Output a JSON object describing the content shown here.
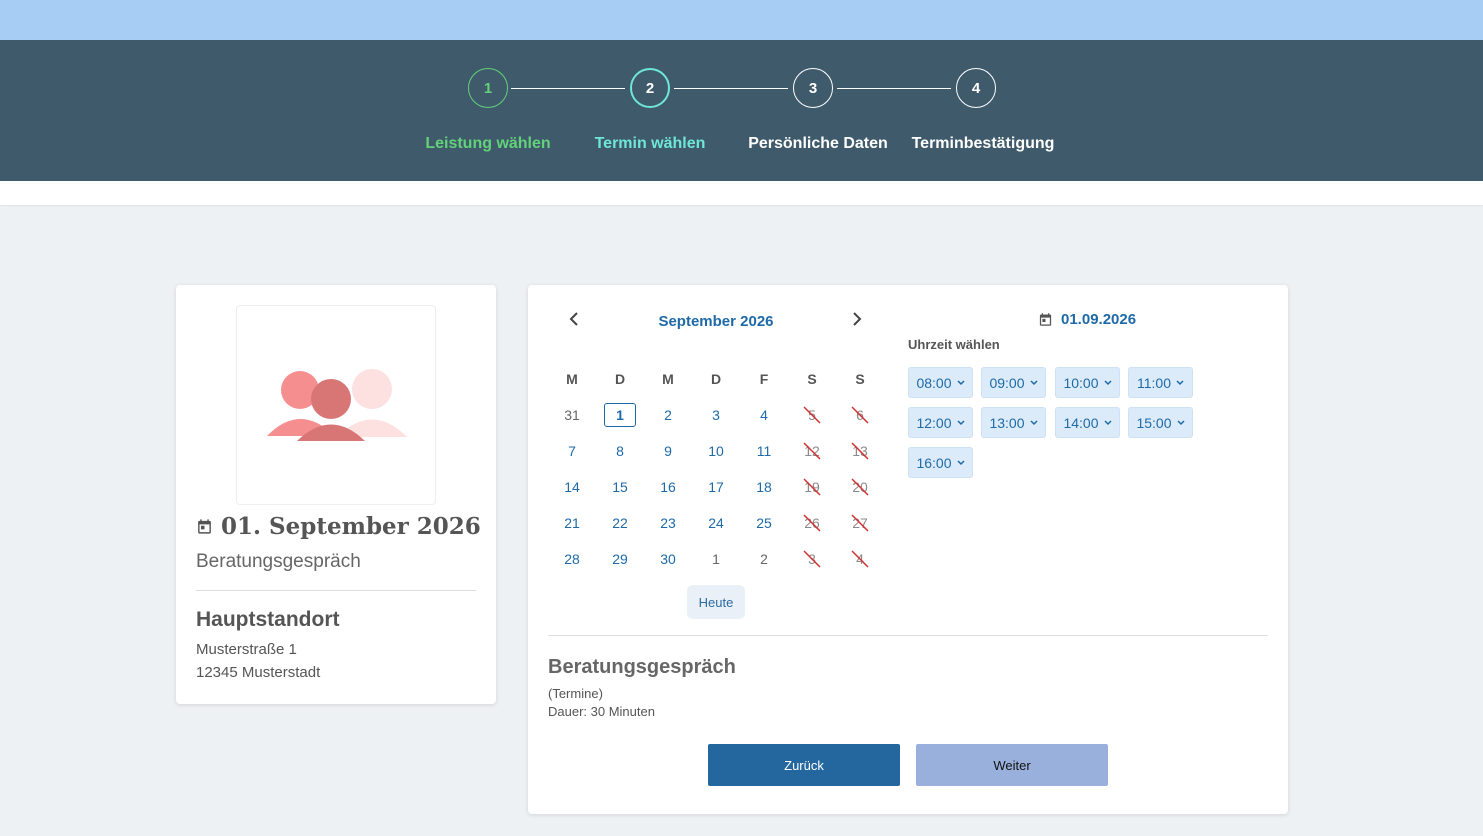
{
  "stepper": {
    "steps": [
      {
        "number": "1",
        "label": "Leistung wählen",
        "state": "done"
      },
      {
        "number": "2",
        "label": "Termin wählen",
        "state": "active"
      },
      {
        "number": "3",
        "label": "Persönliche Daten",
        "state": "pending"
      },
      {
        "number": "4",
        "label": "Terminbestätigung",
        "state": "pending"
      }
    ]
  },
  "summary": {
    "image_icon": "people-group-icon",
    "date": "01. September 2026",
    "service": "Beratungsgespräch",
    "location": {
      "name": "Hauptstandort",
      "street": "Musterstraße 1",
      "city": "12345 Musterstadt"
    }
  },
  "calendar": {
    "month": "September 2026",
    "weekdays": [
      "M",
      "D",
      "M",
      "D",
      "F",
      "S",
      "S"
    ],
    "weeks": [
      [
        "31",
        "1",
        "2",
        "3",
        "4",
        "5",
        "6"
      ],
      [
        "7",
        "8",
        "9",
        "10",
        "11",
        "12",
        "13"
      ],
      [
        "14",
        "15",
        "16",
        "17",
        "18",
        "19",
        "20"
      ],
      [
        "21",
        "22",
        "23",
        "24",
        "25",
        "26",
        "27"
      ],
      [
        "28",
        "29",
        "30",
        "1",
        "2",
        "3",
        "4"
      ]
    ],
    "selected_day": "1",
    "today_label": "Heute"
  },
  "times": {
    "selected_date": "01.09.2026",
    "label": "Uhrzeit wählen",
    "slots": [
      "08:00",
      "09:00",
      "10:00",
      "11:00",
      "12:00",
      "13:00",
      "14:00",
      "15:00",
      "16:00"
    ]
  },
  "service": {
    "title": "Beratungsgespräch",
    "note": "(Termine)",
    "duration": "Dauer: 30 Minuten"
  },
  "actions": {
    "back_label": "Zurück",
    "next_label": "Weiter"
  },
  "colors": {
    "accent": "#1e6aa8",
    "header": "#3f5b6b",
    "done": "#62d17a",
    "active": "#6ee7d6"
  }
}
